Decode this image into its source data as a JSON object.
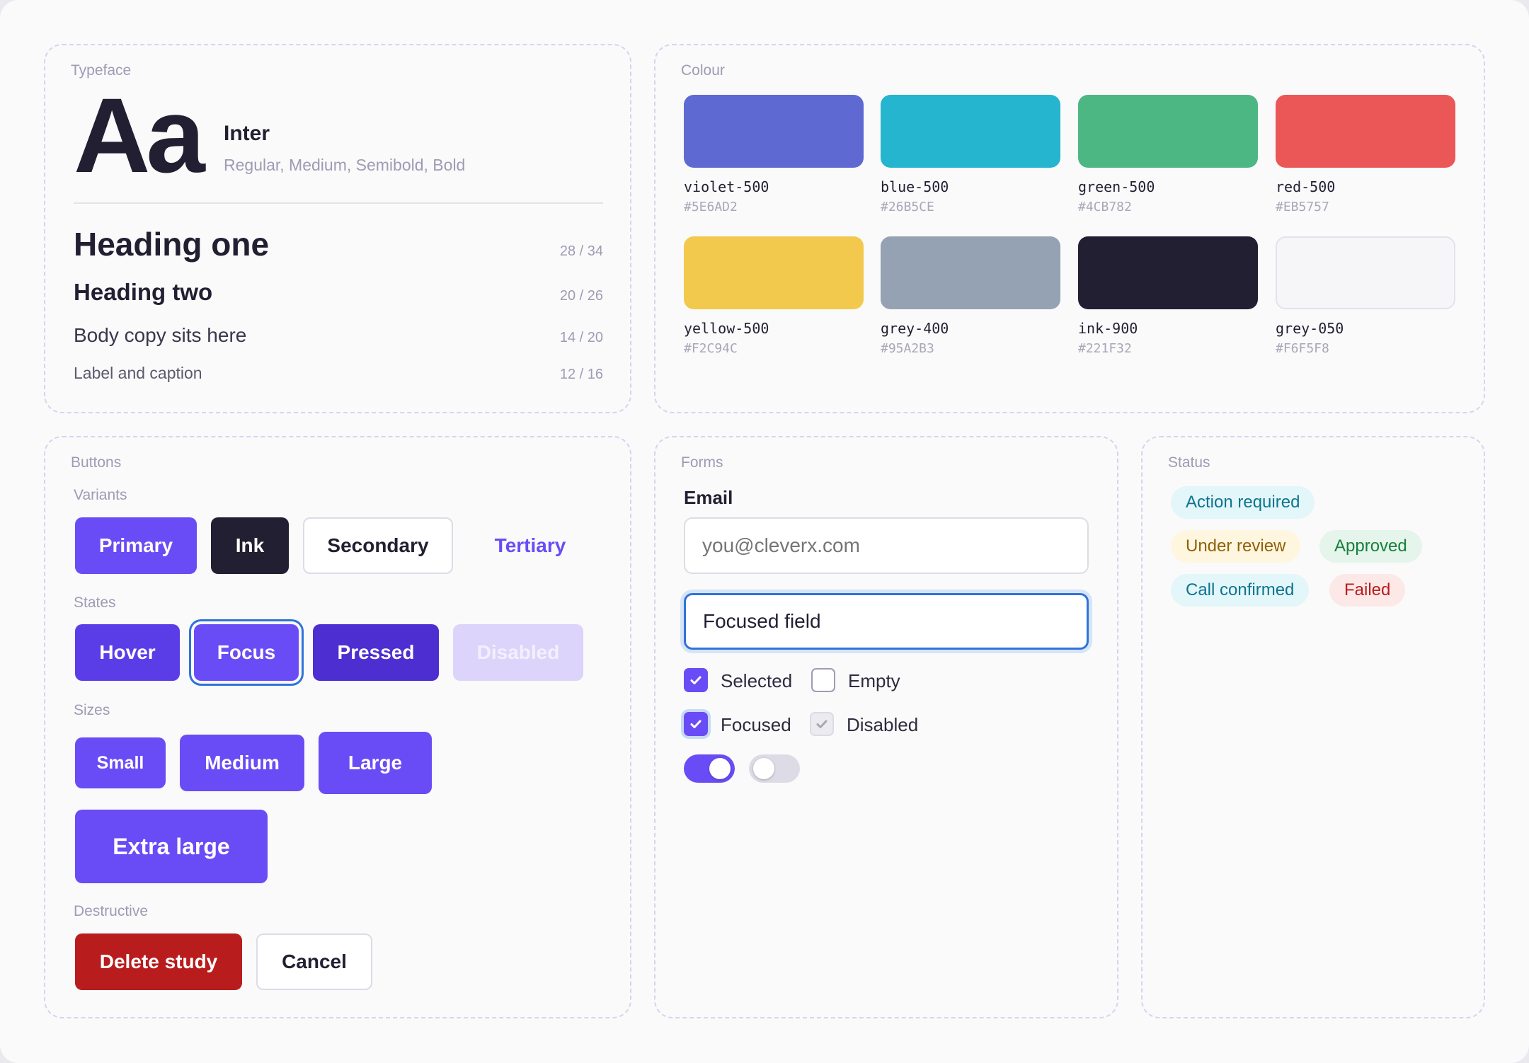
{
  "typeface": {
    "title": "Typeface",
    "sample": "Aa",
    "font_name": "Inter",
    "weights": "Regular, Medium, Semibold, Bold",
    "scale": [
      {
        "label": "Heading one",
        "spec": "28 / 34"
      },
      {
        "label": "Heading two",
        "spec": "20 / 26"
      },
      {
        "label": "Body copy sits here",
        "spec": "14 / 20"
      },
      {
        "label": "Label and caption",
        "spec": "12 / 16"
      }
    ]
  },
  "colour": {
    "title": "Colour",
    "swatches": [
      {
        "name": "violet-500",
        "hex": "#5E6AD2"
      },
      {
        "name": "blue-500",
        "hex": "#26B5CE"
      },
      {
        "name": "green-500",
        "hex": "#4CB782"
      },
      {
        "name": "red-500",
        "hex": "#EB5757"
      },
      {
        "name": "yellow-500",
        "hex": "#F2C94C"
      },
      {
        "name": "grey-400",
        "hex": "#95A2B3"
      },
      {
        "name": "ink-900",
        "hex": "#221F32"
      },
      {
        "name": "grey-050",
        "hex": "#F6F5F8"
      }
    ]
  },
  "buttons": {
    "title": "Buttons",
    "variants_label": "Variants",
    "variants": {
      "primary": "Primary",
      "ink": "Ink",
      "secondary": "Secondary",
      "tertiary": "Tertiary"
    },
    "states_label": "States",
    "states": {
      "hover": "Hover",
      "focus": "Focus",
      "pressed": "Pressed",
      "disabled": "Disabled"
    },
    "sizes_label": "Sizes",
    "sizes": {
      "small": "Small",
      "medium": "Medium",
      "large": "Large",
      "xlarge": "Extra large"
    },
    "destructive_label": "Destructive",
    "destructive": {
      "delete": "Delete study",
      "cancel": "Cancel"
    }
  },
  "forms": {
    "title": "Forms",
    "email_label": "Email",
    "email_placeholder": "you@cleverx.com",
    "focused_value": "Focused field",
    "checkboxes": {
      "selected": "Selected",
      "empty": "Empty",
      "focused": "Focused",
      "disabled": "Disabled"
    },
    "toggles": {
      "on": true,
      "off": false
    }
  },
  "status": {
    "title": "Status",
    "pills": {
      "action_required": "Action required",
      "under_review": "Under review",
      "approved": "Approved",
      "call_confirmed": "Call confirmed",
      "failed": "Failed"
    }
  },
  "colors": {
    "primary": "#6A4CF6",
    "hover": "#5B3DE8",
    "pressed": "#4C2ED1",
    "disabled": "#DCD4FA",
    "ink": "#221F32",
    "danger": "#B91C1C",
    "focus_ring": "#2F73D9"
  }
}
